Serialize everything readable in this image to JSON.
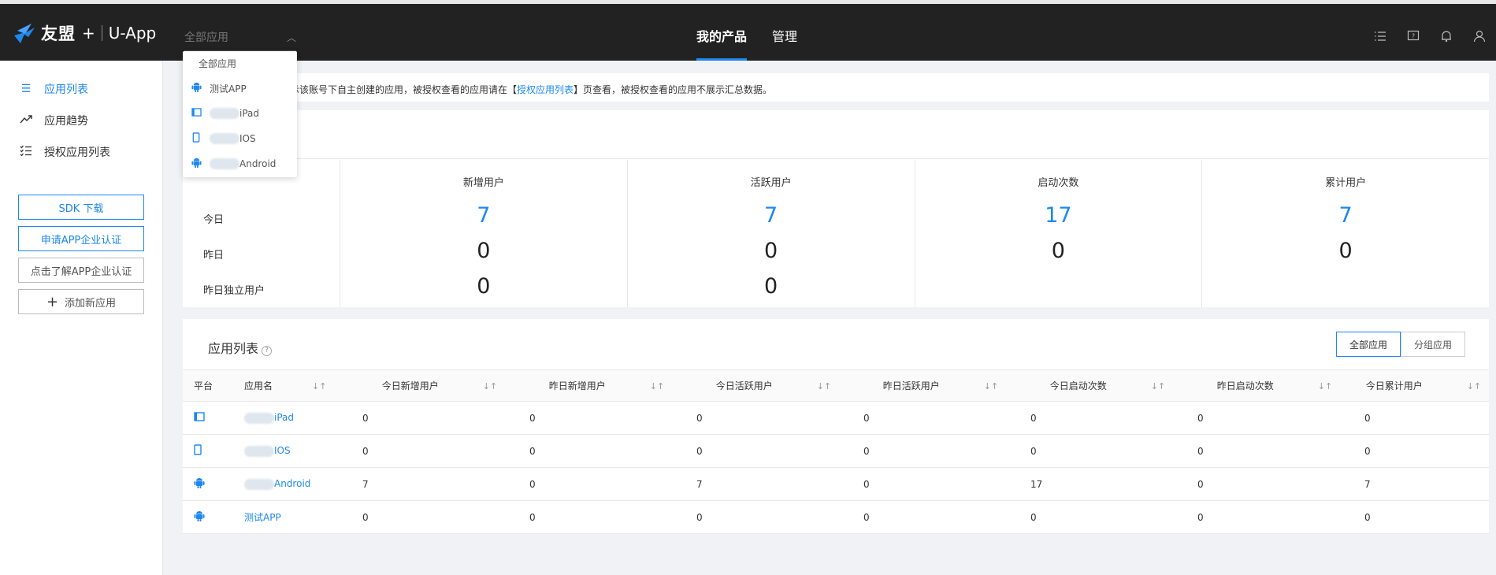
{
  "header": {
    "brand": "友盟",
    "plus": "+",
    "product": "U-App",
    "app_select_placeholder": "全部应用",
    "nav": [
      {
        "label": "我的产品",
        "active": true
      },
      {
        "label": "管理",
        "active": false
      }
    ]
  },
  "dropdown": {
    "items": [
      {
        "label": "全部应用",
        "icon": "none"
      },
      {
        "label": "测试APP",
        "icon": "android-icon"
      },
      {
        "label": "iPad",
        "icon": "tablet-icon"
      },
      {
        "label": "IOS",
        "icon": "phone-icon"
      },
      {
        "label": "Android",
        "icon": "android-icon"
      }
    ]
  },
  "sidebar": {
    "items": [
      {
        "label": "应用列表",
        "icon": "list-icon",
        "active": true
      },
      {
        "label": "应用趋势",
        "icon": "trend-icon",
        "active": false
      },
      {
        "label": "授权应用列表",
        "icon": "checklist-icon",
        "active": false
      }
    ],
    "buttons": {
      "sdk": "SDK 下载",
      "apply_cert": "申请APP企业认证",
      "learn_cert": "点击了解APP企业认证",
      "add_app": "添加新应用"
    }
  },
  "notice": {
    "text_before": "只展示该账号下自主创建的应用，被授权查看的应用请在【",
    "link": "授权应用列表",
    "text_after": "】页查看，被授权查看的应用不展示汇总数据。"
  },
  "summary": {
    "rows": [
      "今日",
      "昨日",
      "昨日独立用户"
    ],
    "columns": [
      {
        "title": "新增用户",
        "today": "7",
        "yesterday": "0",
        "unique": "0"
      },
      {
        "title": "活跃用户",
        "today": "7",
        "yesterday": "0",
        "unique": "0"
      },
      {
        "title": "启动次数",
        "today": "17",
        "yesterday": "0",
        "unique": ""
      },
      {
        "title": "累计用户",
        "today": "7",
        "yesterday": "0",
        "unique": ""
      }
    ]
  },
  "app_list": {
    "title": "应用列表",
    "help": "?",
    "tabs": [
      "全部应用",
      "分组应用"
    ],
    "sort_glyph": "↓↑",
    "headers": [
      "平台",
      "应用名",
      "今日新增用户",
      "昨日新增用户",
      "今日活跃用户",
      "昨日活跃用户",
      "今日启动次数",
      "昨日启动次数",
      "今日累计用户"
    ],
    "rows": [
      {
        "platform": "tablet-icon",
        "name": "iPad",
        "values": [
          "0",
          "0",
          "0",
          "0",
          "0",
          "0",
          "0"
        ]
      },
      {
        "platform": "phone-icon",
        "name": "IOS",
        "values": [
          "0",
          "0",
          "0",
          "0",
          "0",
          "0",
          "0"
        ]
      },
      {
        "platform": "android-icon",
        "name": "Android",
        "values": [
          "7",
          "0",
          "7",
          "0",
          "17",
          "0",
          "7"
        ]
      },
      {
        "platform": "android-icon",
        "name": "测试APP",
        "values": [
          "0",
          "0",
          "0",
          "0",
          "0",
          "0",
          "0"
        ]
      }
    ]
  },
  "colors": {
    "accent": "#1e87f0",
    "topbar": "#222222"
  }
}
